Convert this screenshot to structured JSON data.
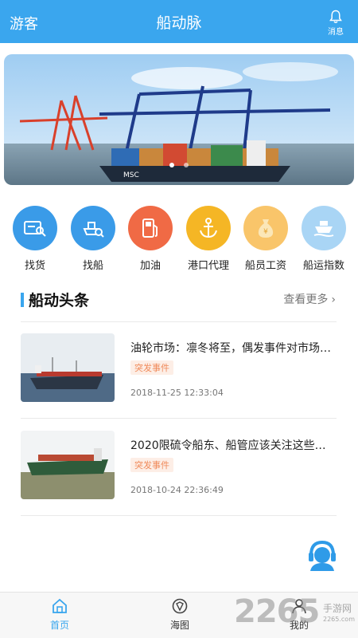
{
  "header": {
    "guest_label": "游客",
    "title": "船动脉",
    "message_label": "消息"
  },
  "banner": {
    "ship_text": "MSC",
    "slides": 2,
    "active_slide": 1
  },
  "actions": [
    {
      "label": "找货",
      "icon": "find-cargo-icon",
      "color": "#3a9be8"
    },
    {
      "label": "找船",
      "icon": "find-ship-icon",
      "color": "#3a9be8"
    },
    {
      "label": "加油",
      "icon": "fuel-icon",
      "color": "#f06a45"
    },
    {
      "label": "港口代理",
      "icon": "anchor-icon",
      "color": "#f5b625"
    },
    {
      "label": "船员工资",
      "icon": "money-bag-icon",
      "color": "#f9c56a"
    },
    {
      "label": "船运指数",
      "icon": "ship-index-icon",
      "color": "#a9d5f5"
    }
  ],
  "section": {
    "title": "船动头条",
    "more_label": "查看更多"
  },
  "news": [
    {
      "title": "油轮市场：凛冬将至，偶发事件对市场…",
      "tag": "突发事件",
      "time": "2018-11-25 12:33:04"
    },
    {
      "title": "2020限硫令船东、船管应该关注这些…",
      "tag": "突发事件",
      "time": "2018-10-24 22:36:49"
    }
  ],
  "bottom_nav": [
    {
      "label": "首页",
      "icon": "home-icon",
      "active": true
    },
    {
      "label": "海图",
      "icon": "chart-map-icon",
      "active": false
    },
    {
      "label": "我的",
      "icon": "profile-icon",
      "active": false
    }
  ],
  "watermark": {
    "number": "2265",
    "site": "手游网",
    "host": "2265.com"
  },
  "colors": {
    "primary": "#3aa6ee",
    "tag_text": "#f08a5a",
    "tag_bg": "#fdeee6"
  }
}
